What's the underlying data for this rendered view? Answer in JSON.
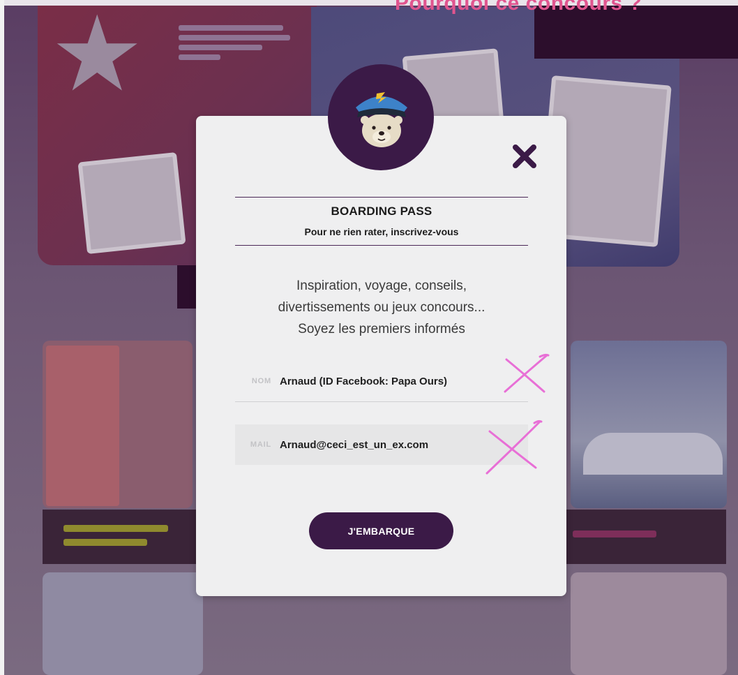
{
  "background": {
    "heading": "Pourquoi ce concours ?"
  },
  "modal": {
    "title": "BOARDING PASS",
    "subtitle": "Pour ne rien rater, inscrivez-vous",
    "description_lines": [
      "Inspiration, voyage, conseils,",
      "divertissements ou jeux concours...",
      "Soyez les premiers informés"
    ],
    "fields": {
      "nom": {
        "label": "NOM",
        "value": "Arnaud (ID Facebook: Papa Ours)"
      },
      "mail": {
        "label": "MAIL",
        "value": "Arnaud@ceci_est_un_ex.com"
      }
    },
    "submit_label": "J'EMBARQUE",
    "close_icon": "close-x-icon",
    "avatar_icon": "bear-pilot-icon"
  },
  "colors": {
    "primary": "#3b1a47",
    "annotation_cross": "#e86fd6",
    "modal_bg": "#efeff0",
    "heading_pink": "#e0558f"
  }
}
